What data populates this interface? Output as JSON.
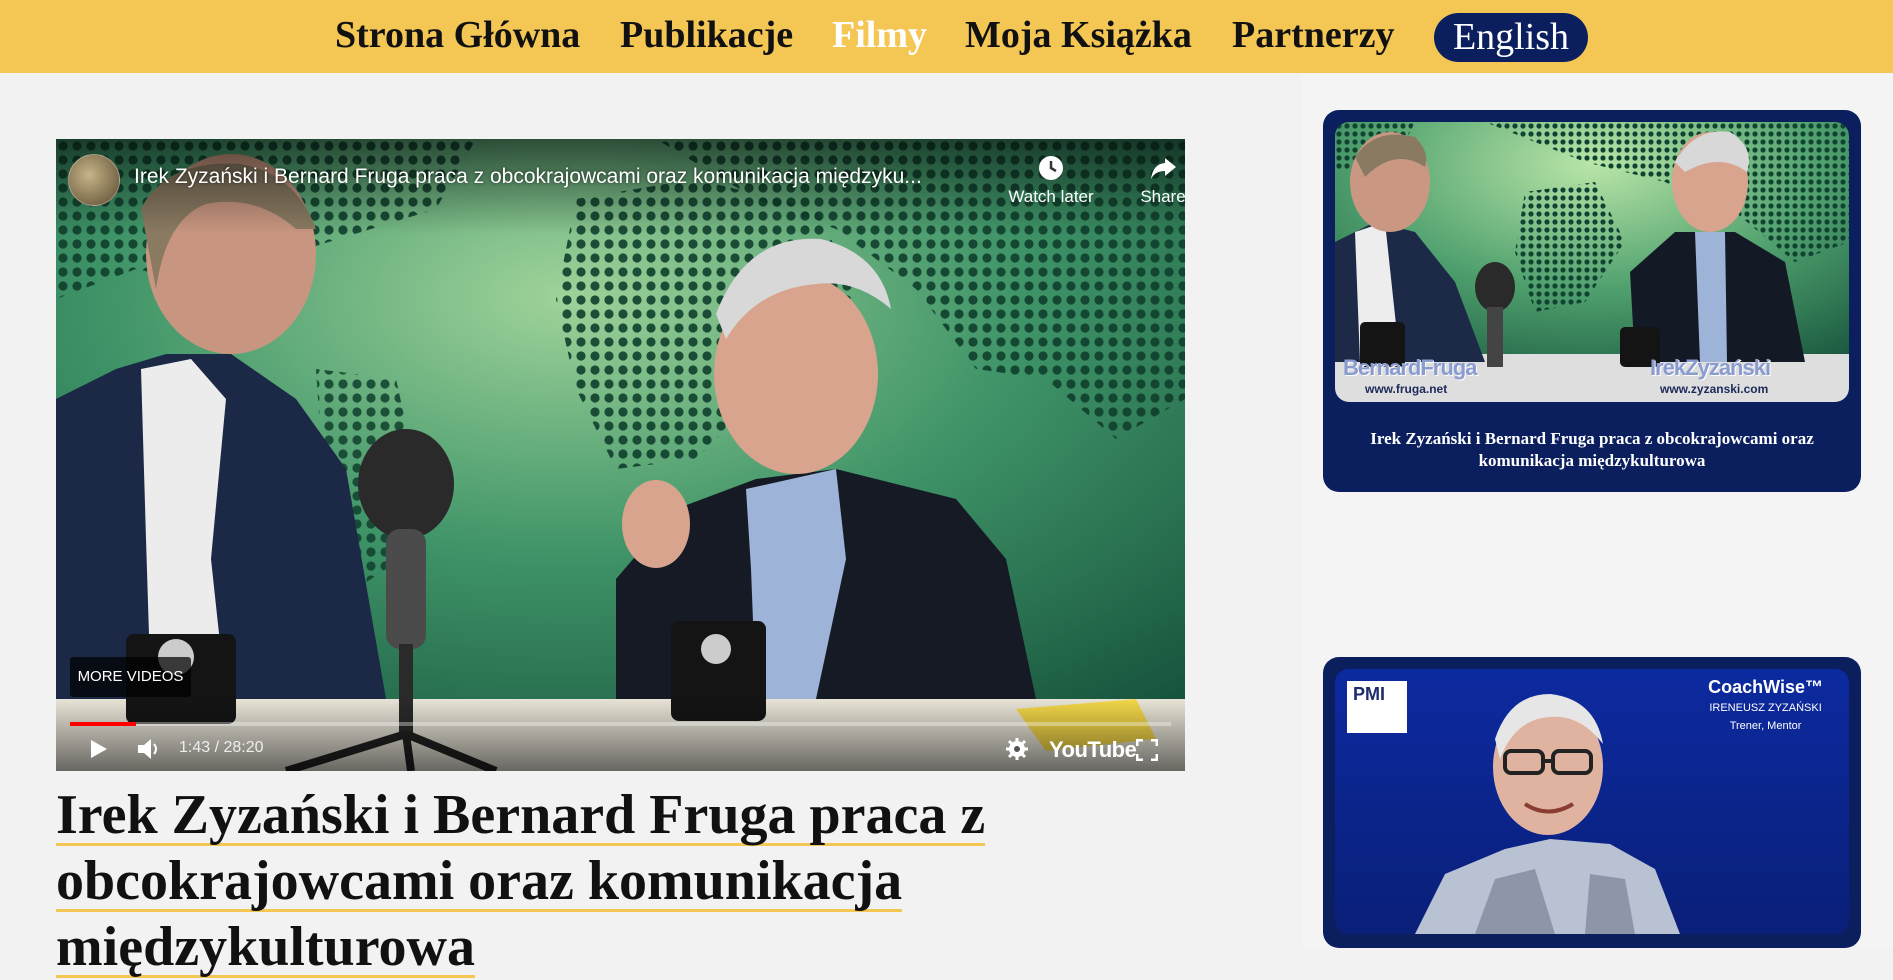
{
  "nav": {
    "items": [
      {
        "label": "Strona Główna",
        "active": false
      },
      {
        "label": "Publikacje",
        "active": false
      },
      {
        "label": "Filmy",
        "active": true
      },
      {
        "label": "Moja Książka",
        "active": false
      },
      {
        "label": "Partnerzy",
        "active": false
      }
    ],
    "language_button": "English"
  },
  "player": {
    "title": "Irek Zyzański i Bernard Fruga praca z obcokrajowcami oraz komunikacja międzyku...",
    "watch_later": "Watch later",
    "share": "Share",
    "more_videos": "MORE VIDEOS",
    "time": "1:43 / 28:20",
    "progress": 0.06,
    "brand": "YouTube"
  },
  "page": {
    "title": "Irek Zyzański i Bernard Fruga praca z obcokrajowcami oraz komunikacja międzykulturowa"
  },
  "sidebar": {
    "cards": [
      {
        "caption": "Irek Zyzański i Bernard Fruga praca z obcokrajowcami oraz komunikacja międzykulturowa",
        "thumb_left_name": "BernardFruga",
        "thumb_left_url": "www.fruga.net",
        "thumb_right_name": "IrekZyzański",
        "thumb_right_url": "www.zyzanski.com"
      },
      {
        "brand": "CoachWise™",
        "person": "IRENEUSZ ZYZAŃSKI",
        "role": "Trener, Mentor",
        "logo": "PMI"
      }
    ]
  },
  "colors": {
    "nav_bg": "#f4c653",
    "accent_navy": "#0b1f5e",
    "progress_red": "#ff0000"
  }
}
